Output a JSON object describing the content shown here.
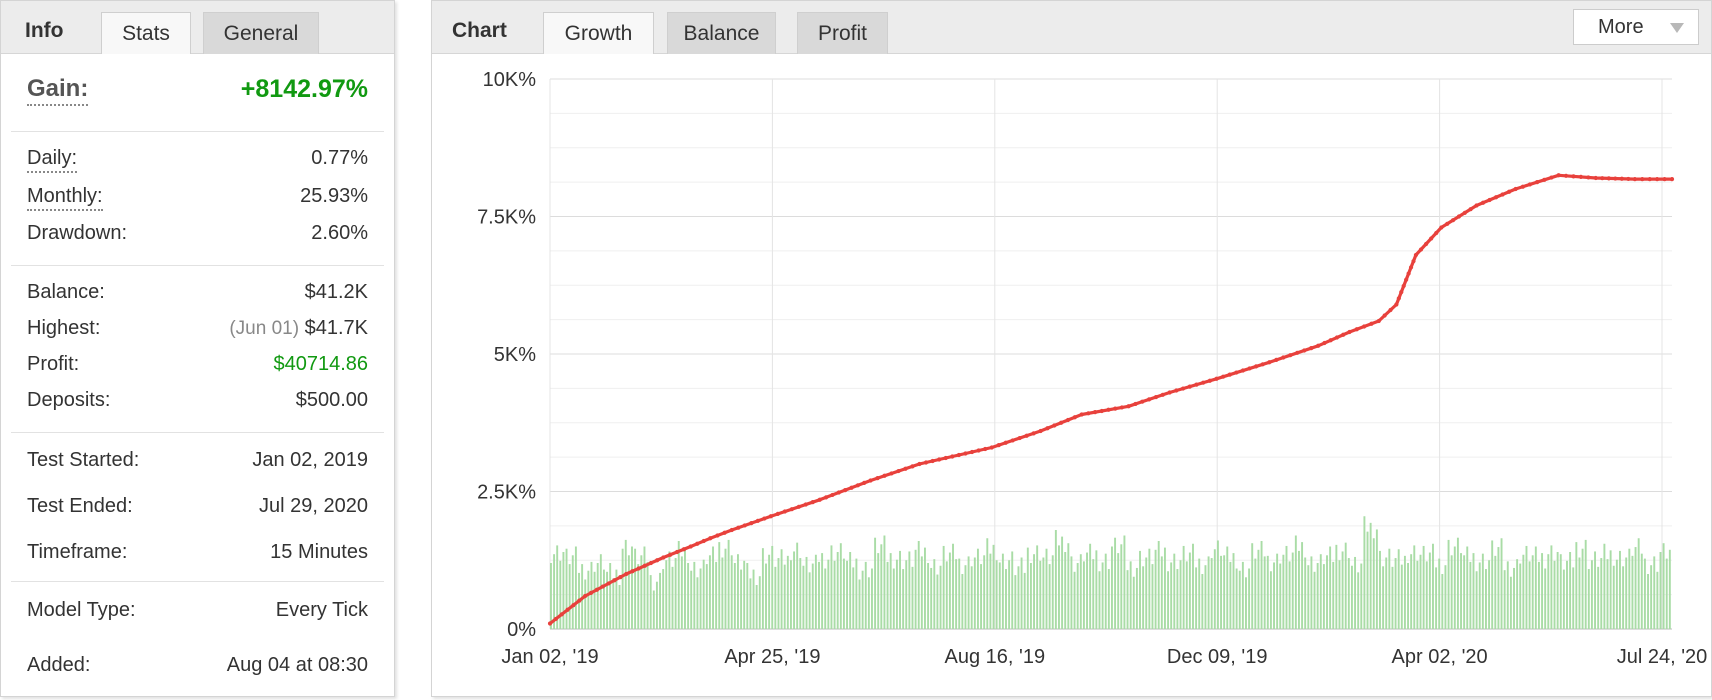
{
  "info_panel": {
    "tabs": [
      {
        "label": "Info"
      },
      {
        "label": "Stats"
      },
      {
        "label": "General"
      }
    ],
    "gain": {
      "label": "Gain:",
      "value": "+8142.97%"
    },
    "daily": {
      "label": "Daily:",
      "value": "0.77%"
    },
    "monthly": {
      "label": "Monthly:",
      "value": "25.93%"
    },
    "drawdown": {
      "label": "Drawdown:",
      "value": "2.60%"
    },
    "balance": {
      "label": "Balance:",
      "value": "$41.2K"
    },
    "highest": {
      "label": "Highest:",
      "date": "(Jun 01)",
      "value": "$41.7K"
    },
    "profit": {
      "label": "Profit:",
      "value": "$40714.86"
    },
    "deposits": {
      "label": "Deposits:",
      "value": "$500.00"
    },
    "test_started": {
      "label": "Test Started:",
      "value": "Jan 02, 2019"
    },
    "test_ended": {
      "label": "Test Ended:",
      "value": "Jul 29, 2020"
    },
    "timeframe": {
      "label": "Timeframe:",
      "value": "15 Minutes"
    },
    "model_type": {
      "label": "Model Type:",
      "value": "Every Tick"
    },
    "added": {
      "label": "Added:",
      "value": "Aug 04 at 08:30"
    }
  },
  "chart_panel": {
    "title": "Chart",
    "tabs": [
      {
        "label": "Growth"
      },
      {
        "label": "Balance"
      },
      {
        "label": "Profit"
      }
    ],
    "more_label": "More",
    "more_icon": "chevron-down-icon"
  },
  "colors": {
    "line": "#e8413c",
    "bars": "#a9dca6",
    "gain_green": "#119911"
  },
  "chart_data": {
    "type": "line",
    "title": "",
    "xlabel": "",
    "ylabel": "",
    "ylim": [
      0,
      10000
    ],
    "y_ticks": [
      "0%",
      "2.5K%",
      "5K%",
      "7.5K%",
      "10K%"
    ],
    "x_ticks": [
      "Jan 02, '19",
      "Apr 25, '19",
      "Aug 16, '19",
      "Dec 09, '19",
      "Apr 02, '20",
      "Jul 24, '20"
    ],
    "x_range": [
      "2019-01-02",
      "2020-07-29"
    ],
    "grid": true,
    "series": [
      {
        "type": "line",
        "x": [
          "2019-01-02",
          "2019-01-20",
          "2019-02-10",
          "2019-03-01",
          "2019-03-15",
          "2019-03-25",
          "2019-04-05",
          "2019-04-25",
          "2019-05-20",
          "2019-06-15",
          "2019-07-10",
          "2019-08-16",
          "2019-09-10",
          "2019-10-01",
          "2019-10-25",
          "2019-11-15",
          "2019-12-09",
          "2020-01-05",
          "2020-01-30",
          "2020-02-15",
          "2020-03-01",
          "2020-03-10",
          "2020-03-20",
          "2020-04-02",
          "2020-04-20",
          "2020-05-10",
          "2020-06-01",
          "2020-06-20",
          "2020-07-10",
          "2020-07-29"
        ],
        "values": [
          100,
          600,
          1000,
          1300,
          1500,
          1650,
          1800,
          2050,
          2350,
          2700,
          3000,
          3300,
          3600,
          3900,
          4050,
          4300,
          4550,
          4850,
          5150,
          5400,
          5600,
          5900,
          6800,
          7300,
          7700,
          8000,
          8250,
          8200,
          8180,
          8180
        ]
      },
      {
        "type": "bar",
        "description_values_are_daily_activity": true,
        "values": [
          1400,
          1300,
          1100,
          1200,
          1000,
          1500,
          1300,
          900,
          1250,
          1400,
          1100,
          1300,
          1500,
          1200,
          1000,
          1350,
          1250,
          1450,
          1150,
          1300,
          1400,
          1200,
          1100,
          1500,
          1300,
          1250,
          1400,
          1150,
          1350,
          1200,
          1300,
          1450,
          1250,
          1100,
          1400,
          1300,
          1600,
          1200,
          1350,
          1250,
          1500,
          1150,
          1300,
          1400,
          1250,
          1350,
          1200,
          1450,
          1300,
          1100,
          1400,
          1250,
          1350,
          1500,
          1200,
          1300,
          1450,
          1150,
          1850,
          1300,
          1250,
          1400,
          1350,
          1200,
          1500,
          1300,
          1250,
          1450,
          1150,
          1350,
          1300,
          1400,
          1200,
          1500,
          1250,
          1350,
          1300,
          1450,
          1200,
          1400
        ]
      }
    ]
  }
}
